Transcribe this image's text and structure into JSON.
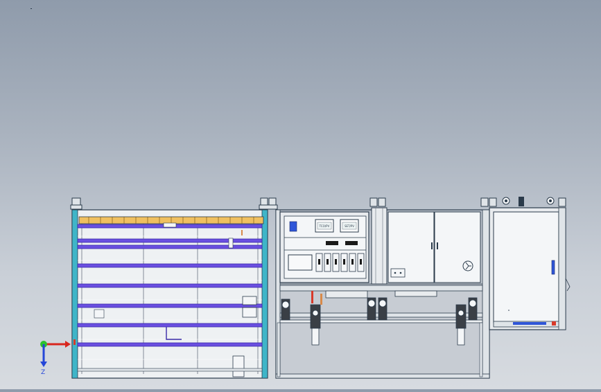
{
  "viewport": {
    "background_top": "#8f9bab",
    "background_bottom": "#d7dbe0"
  },
  "colors": {
    "frame": "#2a3a4a",
    "rail_cyan": "#3fb5c8",
    "shelf_purple": "#6a4fe0",
    "shelf_purple_dark": "#3a2aa8",
    "panel_white": "#f4f6f8",
    "roller_yellow": "#f0c060",
    "indicator_blue": "#2f56d8",
    "indicator_red": "#d83a2a"
  },
  "control_panel": {
    "screen_a_label": "TCO/PV",
    "screen_b_label": "SET/PV"
  },
  "triad": {
    "x_axis_color": "#d8261e",
    "y_axis_color": "#2ec22e",
    "z_axis_color": "#2547d8",
    "z_label": "Z"
  }
}
